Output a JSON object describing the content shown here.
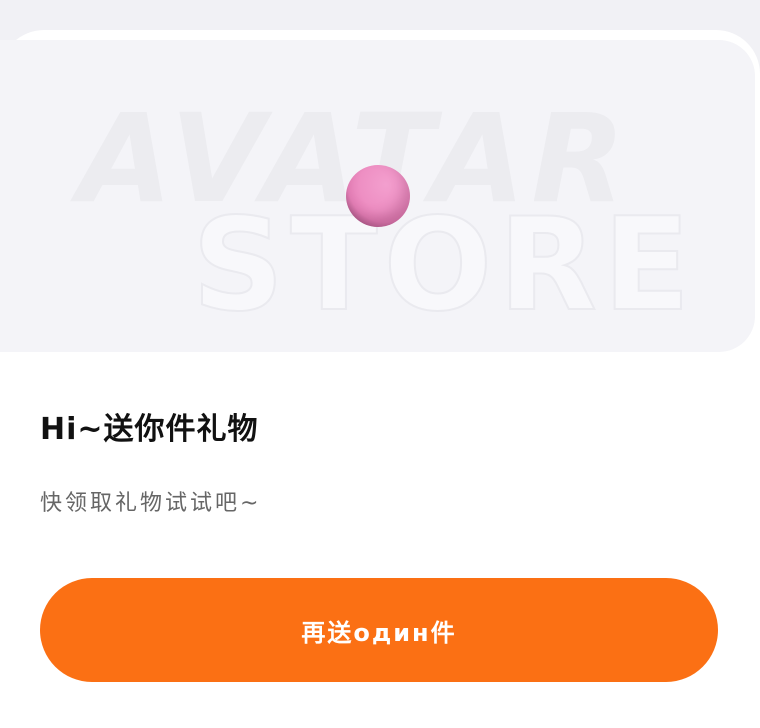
{
  "banner": {
    "watermark_line1": "AVATAR",
    "watermark_line2": "STORE",
    "ball_icon": "pink-ball-icon"
  },
  "gift": {
    "title": "Hi~送你件礼物",
    "subtitle": "快领取礼物试试吧~"
  },
  "action": {
    "send_label": "再送один件"
  },
  "colors": {
    "accent": "#fb7014",
    "ball": "#ee8fc3",
    "background": "#f1f1f5",
    "card": "#ffffff"
  }
}
